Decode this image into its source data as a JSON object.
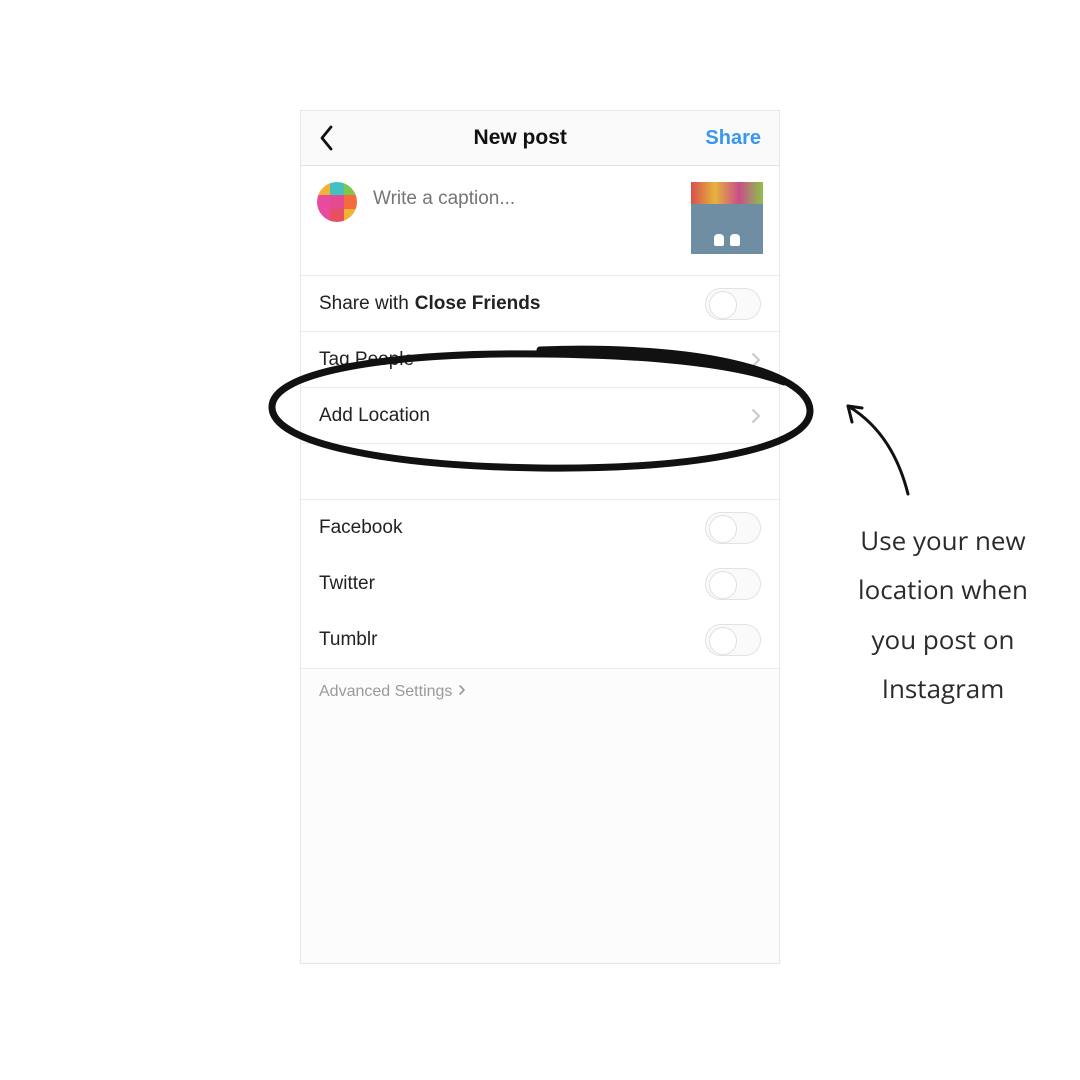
{
  "header": {
    "title": "New post",
    "share": "Share"
  },
  "caption": {
    "placeholder": "Write a caption..."
  },
  "rows": {
    "shareWithPrefix": "Share with",
    "shareWithBold": "Close Friends",
    "tagPeople": "Tag People",
    "addLocation": "Add Location"
  },
  "shareTargets": {
    "facebook": "Facebook",
    "twitter": "Twitter",
    "tumblr": "Tumblr"
  },
  "advanced": "Advanced Settings",
  "annotation": {
    "note": "Use your new location when you post on Instagram"
  },
  "avatarColors": [
    "#f2b233",
    "#44c0c0",
    "#7fc64c",
    "#e84aa0",
    "#e34a8f",
    "#f46b3f",
    "#e84aa0",
    "#e94f63",
    "#f2b233"
  ]
}
